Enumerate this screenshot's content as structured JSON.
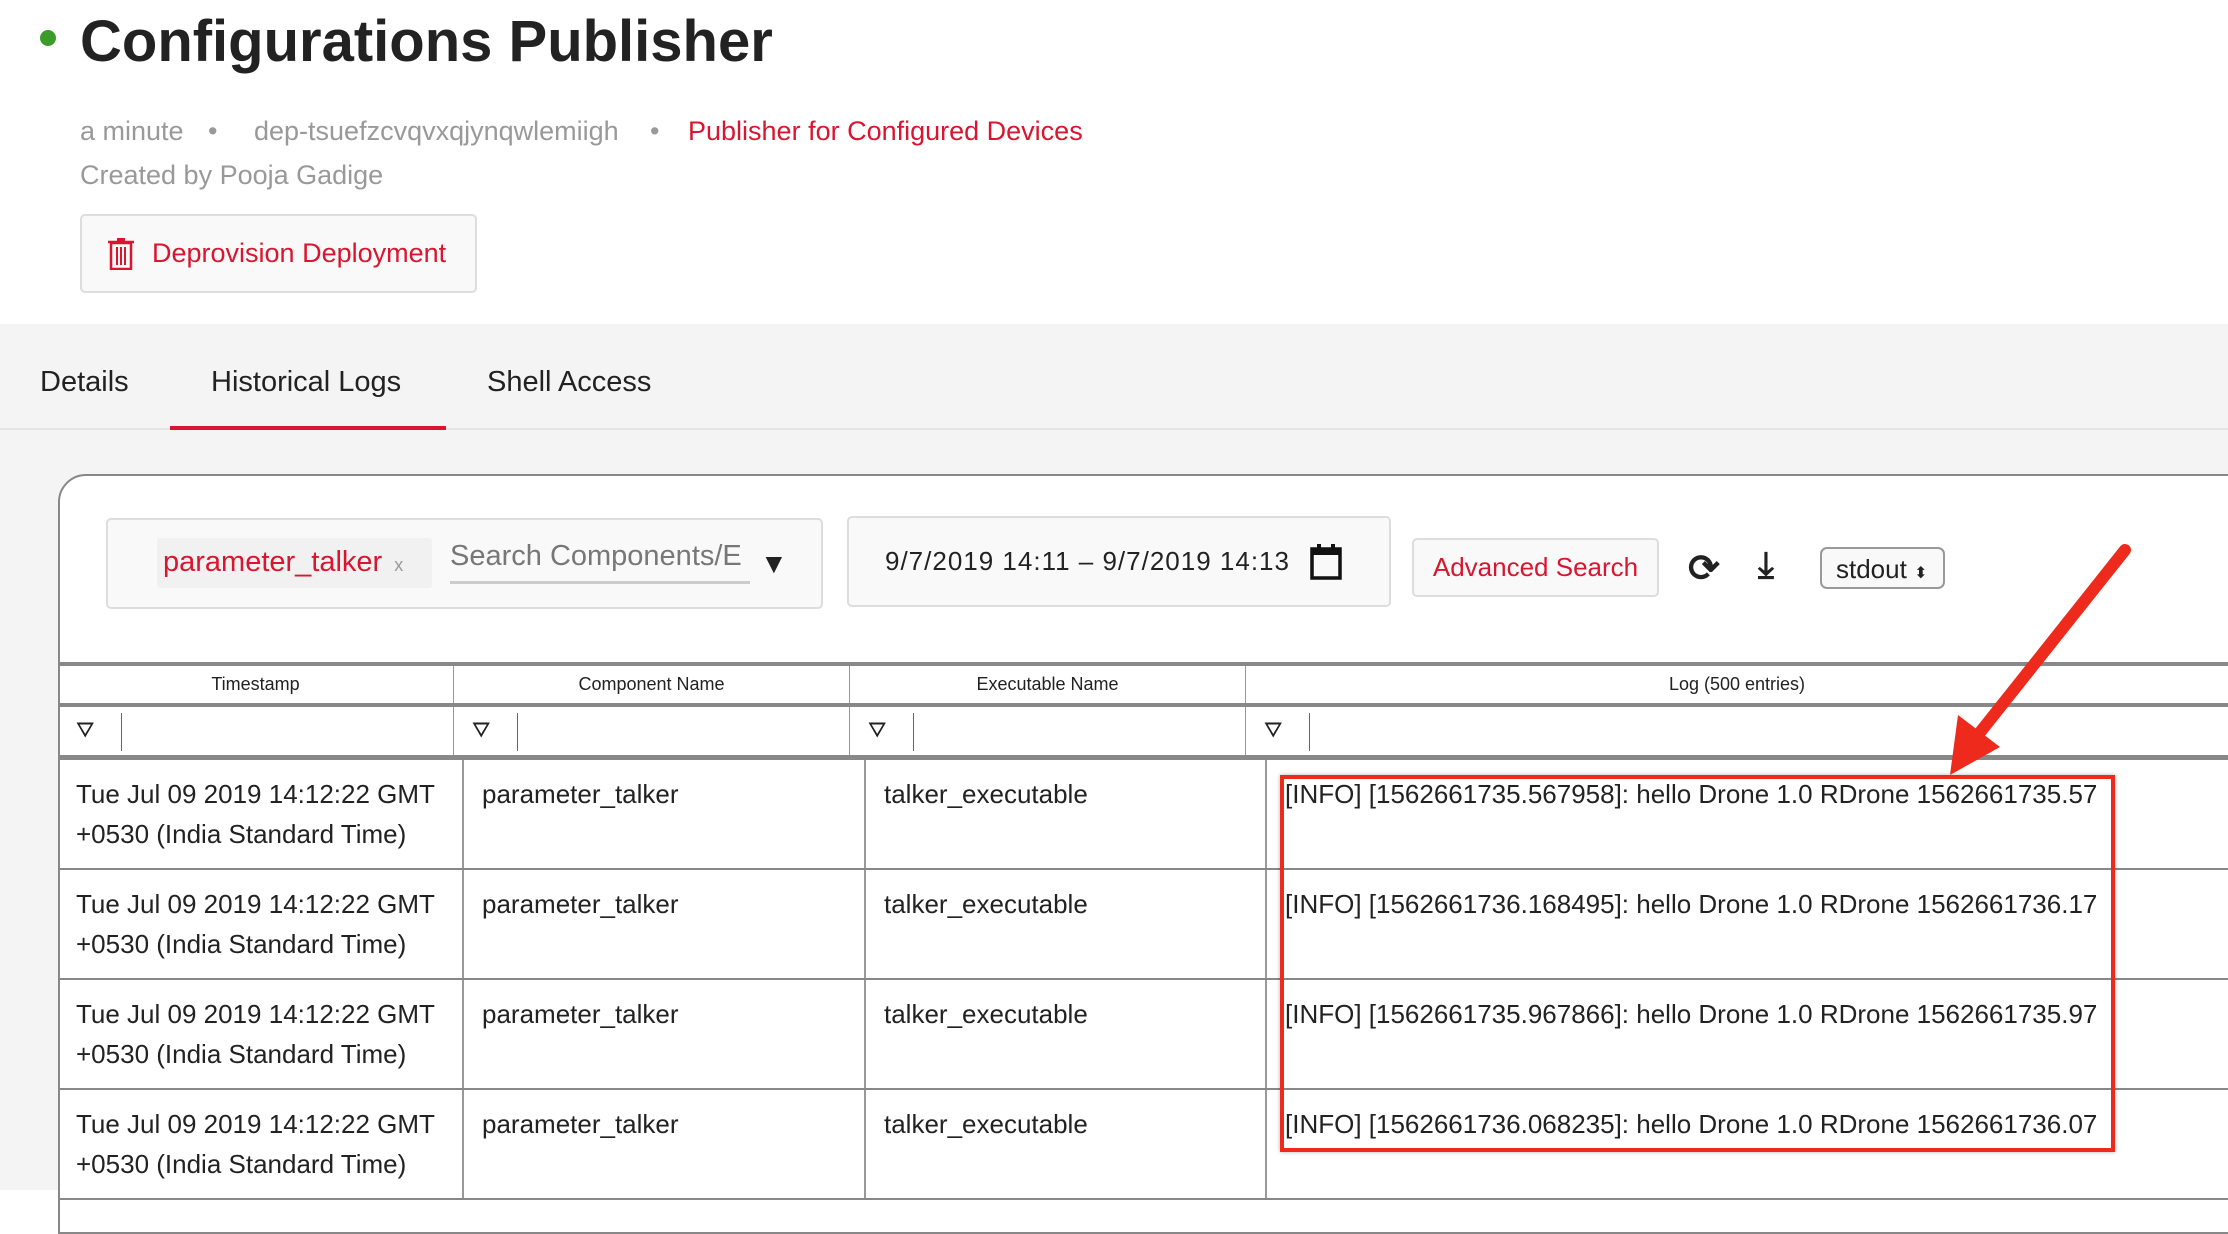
{
  "header": {
    "title": "Configurations Publisher",
    "age": "a minute",
    "deployment_id": "dep-tsuefzcvqvxqjynqwlemiigh",
    "package": "Publisher for Configured Devices",
    "created_by": "Created by Pooja Gadige",
    "separator": "•",
    "deprovision_label": "Deprovision Deployment",
    "status_color": "#3c9c2a"
  },
  "tabs": [
    {
      "label": "Details"
    },
    {
      "label": "Historical Logs",
      "active": true
    },
    {
      "label": "Shell Access"
    }
  ],
  "toolbar": {
    "chip": "parameter_talker",
    "chip_remove": "x",
    "search_placeholder": "Search Components/E",
    "date_range": "9/7/2019  14:11 – 9/7/2019  14:13",
    "advanced_search": "Advanced Search",
    "stream": "stdout"
  },
  "table": {
    "columns": [
      "Timestamp",
      "Component Name",
      "Executable Name",
      "Log (500 entries)"
    ],
    "rows": [
      {
        "timestamp": "Tue Jul 09 2019 14:12:22 GMT +0530 (India Standard Time)",
        "component": "parameter_talker",
        "executable": "talker_executable",
        "log": "[INFO] [1562661735.567958]: hello Drone 1.0 RDrone 1562661735.57"
      },
      {
        "timestamp": "Tue Jul 09 2019 14:12:22 GMT +0530 (India Standard Time)",
        "component": "parameter_talker",
        "executable": "talker_executable",
        "log": "[INFO] [1562661736.168495]: hello Drone 1.0 RDrone 1562661736.17"
      },
      {
        "timestamp": "Tue Jul 09 2019 14:12:22 GMT +0530 (India Standard Time)",
        "component": "parameter_talker",
        "executable": "talker_executable",
        "log": "[INFO] [1562661735.967866]: hello Drone 1.0 RDrone 1562661735.97"
      },
      {
        "timestamp": "Tue Jul 09 2019 14:12:22 GMT +0530 (India Standard Time)",
        "component": "parameter_talker",
        "executable": "talker_executable",
        "log": "[INFO] [1562661736.068235]: hello Drone 1.0 RDrone 1562661736.07"
      }
    ]
  }
}
